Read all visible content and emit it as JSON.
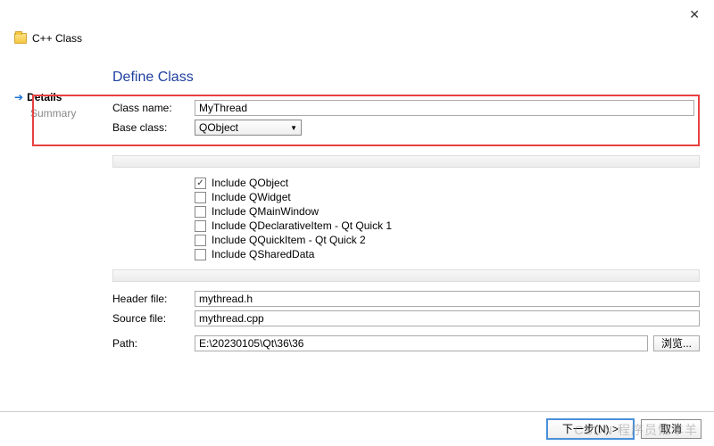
{
  "window": {
    "title": "C++ Class"
  },
  "sidebar": {
    "items": [
      {
        "label": "Details",
        "active": true
      },
      {
        "label": "Summary",
        "active": false
      }
    ]
  },
  "form": {
    "section_title": "Define Class",
    "class_name_label": "Class name:",
    "class_name_value": "MyThread",
    "base_class_label": "Base class:",
    "base_class_value": "QObject",
    "header_label": "Header file:",
    "header_value": "mythread.h",
    "source_label": "Source file:",
    "source_value": "mythread.cpp",
    "path_label": "Path:",
    "path_value": "E:\\20230105\\Qt\\36\\36",
    "browse_label": "浏览..."
  },
  "includes": [
    {
      "label": "Include QObject",
      "checked": true
    },
    {
      "label": "Include QWidget",
      "checked": false
    },
    {
      "label": "Include QMainWindow",
      "checked": false
    },
    {
      "label": "Include QDeclarativeItem - Qt Quick 1",
      "checked": false
    },
    {
      "label": "Include QQuickItem - Qt Quick 2",
      "checked": false
    },
    {
      "label": "Include QSharedData",
      "checked": false
    }
  ],
  "buttons": {
    "next": "下一步(N) >",
    "cancel": "取消"
  },
  "watermark": "CSDN 程序员懒羊羊"
}
